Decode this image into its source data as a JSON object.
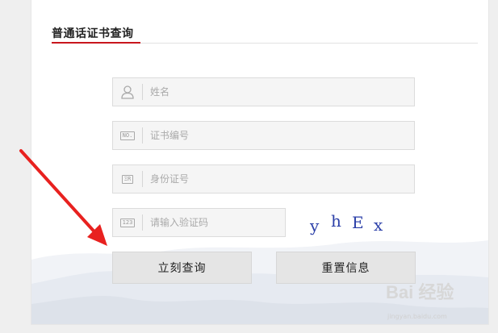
{
  "panel": {
    "title": "普通话证书查询"
  },
  "form": {
    "name_placeholder": "姓名",
    "cert_placeholder": "证书编号",
    "id_placeholder": "身份证号",
    "captcha_placeholder": "请输入验证码",
    "cert_icon_text": "NO.",
    "id_icon_text": "ΞR",
    "captcha_icon_text": "123",
    "captcha_chars": [
      "y",
      "h",
      "E",
      "x"
    ]
  },
  "buttons": {
    "query": "立刻查询",
    "reset": "重置信息"
  },
  "watermark": {
    "text": "Bai 经验",
    "url": "jingyan.baidu.com"
  },
  "colors": {
    "title_underline": "#c8161d",
    "annotation_arrow": "#e8211f",
    "captcha_text": "#2b3fa8"
  }
}
